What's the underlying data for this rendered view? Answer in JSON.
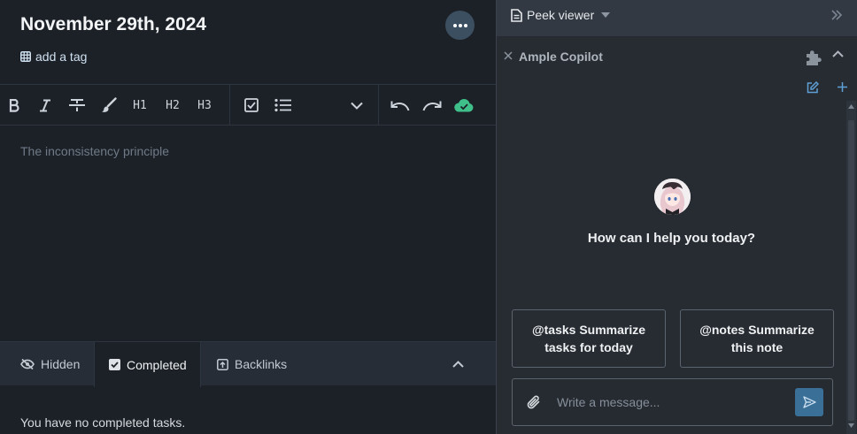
{
  "note": {
    "title": "November 29th, 2024",
    "add_tag_label": "add a tag",
    "editor_placeholder": "The inconsistency principle"
  },
  "toolbar": {
    "h1": "H1",
    "h2": "H2",
    "h3": "H3"
  },
  "tasks_panel": {
    "tabs": [
      {
        "label": "Hidden"
      },
      {
        "label": "Completed"
      },
      {
        "label": "Backlinks"
      }
    ],
    "empty_message": "You have no completed tasks."
  },
  "peek_viewer": {
    "title": "Peek viewer"
  },
  "copilot": {
    "title": "Ample Copilot",
    "greeting": "How can I help you today?",
    "suggestions": [
      {
        "label": "@tasks Summarize tasks for today"
      },
      {
        "label": "@notes Summarize this note"
      }
    ],
    "input_placeholder": "Write a message..."
  },
  "colors": {
    "accent_send": "#3a6f97",
    "cloud_saved": "#3fbf8a",
    "background": "#1c2128",
    "panel": "#272c33"
  },
  "icons": {
    "tag": "tag-grid-icon",
    "cloud": "cloud-check-icon",
    "peek": "document-icon"
  }
}
